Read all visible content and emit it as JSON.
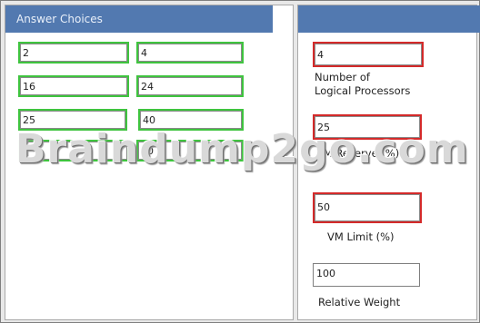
{
  "answer_choices": {
    "title": "Answer Choices",
    "items": [
      "2",
      "4",
      "16",
      "24",
      "25",
      "40",
      "",
      "10"
    ]
  },
  "settings": {
    "logical_processors": {
      "value": "4",
      "label_line1": "Number of",
      "label_line2": "Logical Processors"
    },
    "vm_reserve": {
      "value": "25",
      "label": "VM Reserve (%)"
    },
    "vm_limit": {
      "value": "50",
      "label": "VM Limit (%)"
    },
    "relative_weight": {
      "value": "100",
      "label": "Relative Weight"
    }
  },
  "watermark": "Braindump2go.com"
}
